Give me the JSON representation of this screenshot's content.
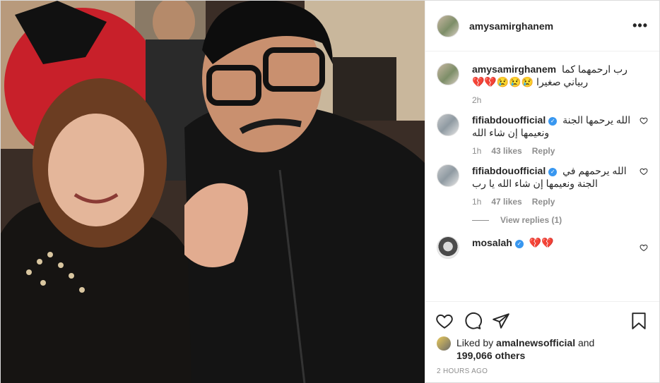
{
  "header": {
    "username": "amysamirghanem",
    "more_label": "•••"
  },
  "comments": [
    {
      "username": "amysamirghanem",
      "verified": false,
      "text": "رب ارحمهما كما ربياني صغيرا 😢😢😢💔💔",
      "time": "2h",
      "likes": "",
      "reply_label": ""
    },
    {
      "username": "fifiabdouofficial",
      "verified": true,
      "text": "الله يرحمها الجنة ونعيمها إن شاء الله",
      "time": "1h",
      "likes": "43 likes",
      "reply_label": "Reply"
    },
    {
      "username": "fifiabdouofficial",
      "verified": true,
      "text": "الله يرحمهم في الجنة ونعيمها إن شاء الله يا رب",
      "time": "1h",
      "likes": "47 likes",
      "reply_label": "Reply"
    },
    {
      "username": "mosalah",
      "verified": true,
      "text": "💔💔",
      "time": "",
      "likes": "",
      "reply_label": ""
    }
  ],
  "view_replies": "View replies (1)",
  "liked_by": {
    "prefix": "Liked by",
    "user": "amalnewsofficial",
    "and": "and",
    "count": "199,066 others"
  },
  "timestamp": "2 hours ago",
  "icons": {
    "like": "heart-icon",
    "comment": "comment-icon",
    "share": "share-icon",
    "save": "bookmark-icon"
  },
  "colors": {
    "heart": "#c81e2b",
    "verified": "#3897f0",
    "muted": "#8e8e8e"
  }
}
